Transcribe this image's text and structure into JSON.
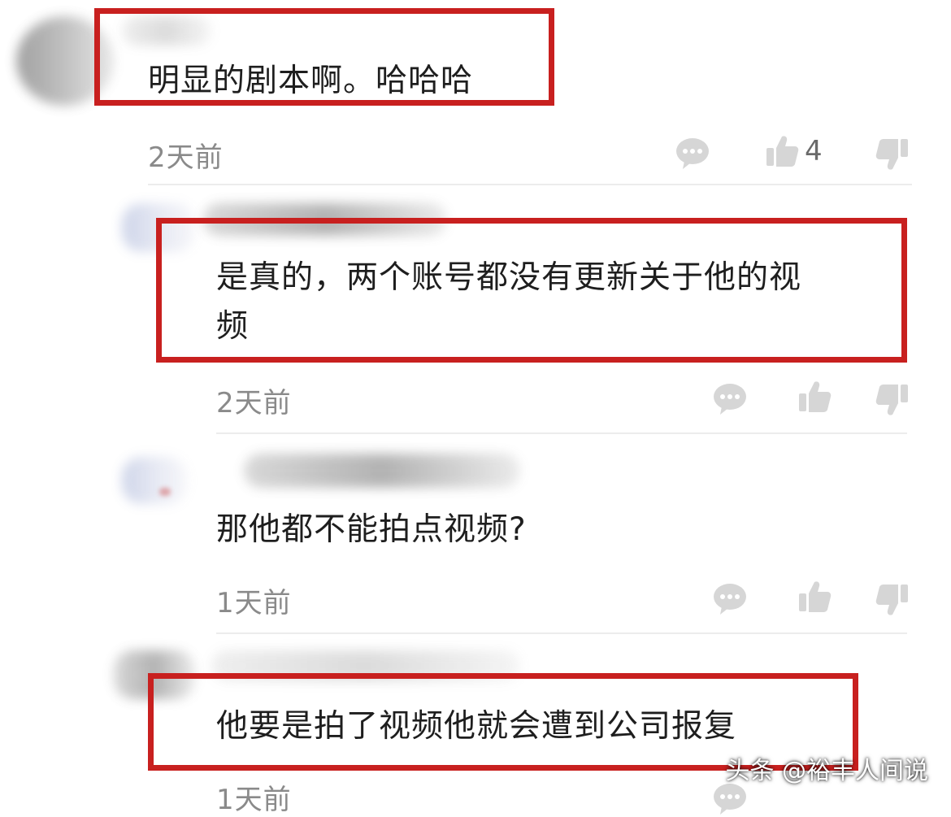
{
  "comments": [
    {
      "text": "明显的剧本啊。哈哈哈",
      "time": "2天前",
      "like_count": "4",
      "highlighted": true
    },
    {
      "text_line1": "是真的，两个账号都没有更新关于他的视",
      "text_line2": "频",
      "time": "2天前",
      "like_count": "",
      "highlighted": true
    },
    {
      "text": "那他都不能拍点视频?",
      "time": "1天前",
      "like_count": "",
      "highlighted": false
    },
    {
      "text": "他要是拍了视频他就会遭到公司报复",
      "time": "1天前",
      "like_count": "",
      "highlighted": true
    }
  ],
  "icons": {
    "reply": "comment-bubble-icon",
    "like": "thumbs-up-icon",
    "dislike": "thumbs-down-icon"
  },
  "colors": {
    "highlight_border": "#c8201f",
    "icon_gray": "#d6d6d6",
    "timestamp_gray": "#8a8a8a"
  },
  "watermark": "头条 @裕丰人间说"
}
